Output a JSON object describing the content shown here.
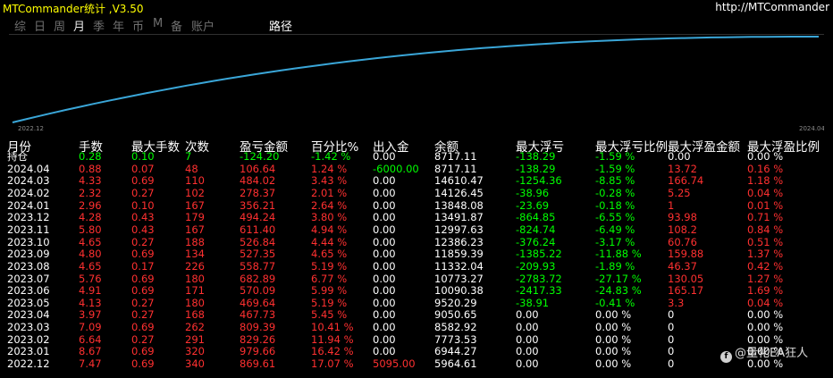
{
  "title_bar": {
    "title": "MTCommander统计 ,V3.50",
    "url": "http://MTCommander"
  },
  "tabs": [
    {
      "label": "综"
    },
    {
      "label": "日"
    },
    {
      "label": "周"
    },
    {
      "label": "月"
    },
    {
      "label": "季"
    },
    {
      "label": "年"
    },
    {
      "label": "币"
    },
    {
      "label": "M"
    },
    {
      "label": "备"
    },
    {
      "label": "账户"
    }
  ],
  "path_button": "路径",
  "chart_data": {
    "type": "line",
    "x_labels": [
      "2022.12",
      "2024.04"
    ],
    "x": [
      "2022.12",
      "2023.01",
      "2023.02",
      "2023.03",
      "2023.04",
      "2023.05",
      "2023.06",
      "2023.07",
      "2023.08",
      "2023.09",
      "2023.10",
      "2023.11",
      "2023.12",
      "2024.01",
      "2024.02",
      "2024.03",
      "2024.04"
    ],
    "values": [
      5964.61,
      6944.27,
      7773.53,
      8582.92,
      9050.65,
      9520.29,
      10090.38,
      10773.27,
      11332.04,
      11859.39,
      12386.23,
      12997.63,
      13491.87,
      13848.08,
      14126.45,
      14610.47,
      8717.11
    ],
    "curve_color": "#3aa6d8",
    "grid": false,
    "series_points": [
      0.0,
      0.12,
      0.22,
      0.3,
      0.35,
      0.39,
      0.45,
      0.52,
      0.57,
      0.62,
      0.67,
      0.72,
      0.76,
      0.8,
      0.84,
      0.9,
      1.0
    ]
  },
  "colors": {
    "header": "#ffffff",
    "green": "#00ff00",
    "red": "#ff3030",
    "white": "#ffffff"
  },
  "columns": [
    "月份",
    "手数",
    "最大手数",
    "次数",
    "盈亏金额",
    "百分比%",
    "出入金",
    "余额",
    "最大浮亏",
    "最大浮亏比例",
    "最大浮盈金额",
    "最大浮盈比例"
  ],
  "position_row": {
    "month": "持仓",
    "lots": "0.28",
    "max_lots": "0.10",
    "count": "7",
    "pnl": "-124.20",
    "pct": "-1.42 %",
    "inout": "0.00",
    "balance": "8717.11",
    "max_dd": "-138.29",
    "max_dd_pct": "-1.59 %",
    "max_fp": "0.00",
    "max_fp_pct": "0.00 %"
  },
  "rows": [
    {
      "month": "2024.04",
      "lots": "0.88",
      "max_lots": "0.07",
      "count": "48",
      "pnl": "106.64",
      "pct": "1.24 %",
      "inout": "-6000.00",
      "balance": "8717.11",
      "max_dd": "-138.29",
      "max_dd_pct": "-1.59 %",
      "max_fp": "13.72",
      "max_fp_pct": "0.16 %"
    },
    {
      "month": "2024.03",
      "lots": "4.33",
      "max_lots": "0.69",
      "count": "110",
      "pnl": "484.02",
      "pct": "3.43 %",
      "inout": "0.00",
      "balance": "14610.47",
      "max_dd": "-1254.36",
      "max_dd_pct": "-8.85 %",
      "max_fp": "166.74",
      "max_fp_pct": "1.18 %"
    },
    {
      "month": "2024.02",
      "lots": "2.32",
      "max_lots": "0.27",
      "count": "102",
      "pnl": "278.37",
      "pct": "2.01 %",
      "inout": "0.00",
      "balance": "14126.45",
      "max_dd": "-38.96",
      "max_dd_pct": "-0.28 %",
      "max_fp": "5.25",
      "max_fp_pct": "0.04 %"
    },
    {
      "month": "2024.01",
      "lots": "2.96",
      "max_lots": "0.10",
      "count": "167",
      "pnl": "356.21",
      "pct": "2.64 %",
      "inout": "0.00",
      "balance": "13848.08",
      "max_dd": "-23.69",
      "max_dd_pct": "-0.18 %",
      "max_fp": "1",
      "max_fp_pct": "0.01 %"
    },
    {
      "month": "2023.12",
      "lots": "4.28",
      "max_lots": "0.43",
      "count": "179",
      "pnl": "494.24",
      "pct": "3.80 %",
      "inout": "0.00",
      "balance": "13491.87",
      "max_dd": "-864.85",
      "max_dd_pct": "-6.55 %",
      "max_fp": "93.98",
      "max_fp_pct": "0.71 %"
    },
    {
      "month": "2023.11",
      "lots": "5.80",
      "max_lots": "0.43",
      "count": "167",
      "pnl": "611.40",
      "pct": "4.94 %",
      "inout": "0.00",
      "balance": "12997.63",
      "max_dd": "-824.74",
      "max_dd_pct": "-6.49 %",
      "max_fp": "108.2",
      "max_fp_pct": "0.84 %"
    },
    {
      "month": "2023.10",
      "lots": "4.65",
      "max_lots": "0.27",
      "count": "188",
      "pnl": "526.84",
      "pct": "4.44 %",
      "inout": "0.00",
      "balance": "12386.23",
      "max_dd": "-376.24",
      "max_dd_pct": "-3.17 %",
      "max_fp": "60.76",
      "max_fp_pct": "0.51 %"
    },
    {
      "month": "2023.09",
      "lots": "4.80",
      "max_lots": "0.69",
      "count": "134",
      "pnl": "527.35",
      "pct": "4.65 %",
      "inout": "0.00",
      "balance": "11859.39",
      "max_dd": "-1385.22",
      "max_dd_pct": "-11.88 %",
      "max_fp": "159.88",
      "max_fp_pct": "1.37 %"
    },
    {
      "month": "2023.08",
      "lots": "4.65",
      "max_lots": "0.17",
      "count": "226",
      "pnl": "558.77",
      "pct": "5.19 %",
      "inout": "0.00",
      "balance": "11332.04",
      "max_dd": "-209.93",
      "max_dd_pct": "-1.89 %",
      "max_fp": "46.37",
      "max_fp_pct": "0.42 %"
    },
    {
      "month": "2023.07",
      "lots": "5.76",
      "max_lots": "0.69",
      "count": "180",
      "pnl": "682.89",
      "pct": "6.77 %",
      "inout": "0.00",
      "balance": "10773.27",
      "max_dd": "-2783.72",
      "max_dd_pct": "-27.17 %",
      "max_fp": "130.05",
      "max_fp_pct": "1.27 %"
    },
    {
      "month": "2023.06",
      "lots": "4.91",
      "max_lots": "0.69",
      "count": "171",
      "pnl": "570.09",
      "pct": "5.99 %",
      "inout": "0.00",
      "balance": "10090.38",
      "max_dd": "-2417.33",
      "max_dd_pct": "-24.83 %",
      "max_fp": "165.17",
      "max_fp_pct": "1.69 %"
    },
    {
      "month": "2023.05",
      "lots": "4.13",
      "max_lots": "0.27",
      "count": "180",
      "pnl": "469.64",
      "pct": "5.19 %",
      "inout": "0.00",
      "balance": "9520.29",
      "max_dd": "-38.91",
      "max_dd_pct": "-0.41 %",
      "max_fp": "3.3",
      "max_fp_pct": "0.04 %"
    },
    {
      "month": "2023.04",
      "lots": "3.97",
      "max_lots": "0.27",
      "count": "168",
      "pnl": "467.73",
      "pct": "5.45 %",
      "inout": "0.00",
      "balance": "9050.65",
      "max_dd": "0.00",
      "max_dd_pct": "0.00 %",
      "max_fp": "0",
      "max_fp_pct": "0.00 %"
    },
    {
      "month": "2023.03",
      "lots": "7.09",
      "max_lots": "0.69",
      "count": "262",
      "pnl": "809.39",
      "pct": "10.41 %",
      "inout": "0.00",
      "balance": "8582.92",
      "max_dd": "0.00",
      "max_dd_pct": "0.00 %",
      "max_fp": "0",
      "max_fp_pct": "0.00 %"
    },
    {
      "month": "2023.02",
      "lots": "6.64",
      "max_lots": "0.27",
      "count": "291",
      "pnl": "829.26",
      "pct": "11.94 %",
      "inout": "0.00",
      "balance": "7773.53",
      "max_dd": "0.00",
      "max_dd_pct": "0.00 %",
      "max_fp": "0",
      "max_fp_pct": "0.00 %"
    },
    {
      "month": "2023.01",
      "lots": "8.67",
      "max_lots": "0.69",
      "count": "320",
      "pnl": "979.66",
      "pct": "16.42 %",
      "inout": "0.00",
      "balance": "6944.27",
      "max_dd": "0.00",
      "max_dd_pct": "0.00 %",
      "max_fp": "0",
      "max_fp_pct": "0.00 %"
    },
    {
      "month": "2022.12",
      "lots": "7.47",
      "max_lots": "0.69",
      "count": "340",
      "pnl": "869.61",
      "pct": "17.07 %",
      "inout": "5095.00",
      "balance": "5964.61",
      "max_dd": "0.00",
      "max_dd_pct": "0.00 %",
      "max_fp": "0",
      "max_fp_pct": "0.00 %"
    }
  ],
  "watermark": {
    "icon": "f",
    "text": "@量化EA狂人"
  }
}
